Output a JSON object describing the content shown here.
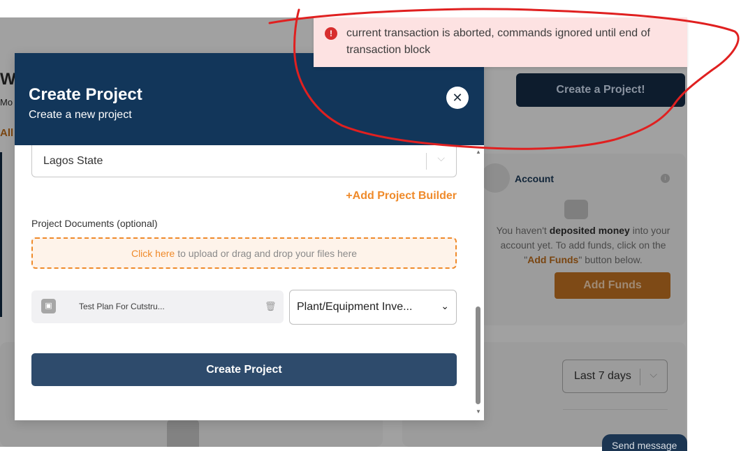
{
  "toast": {
    "message": "current transaction is aborted, commands ignored until end of transaction block",
    "icon": "error-icon",
    "color": "#d72e2e"
  },
  "background": {
    "left_heading": "W",
    "left_sub": "Mo",
    "left_link": "All",
    "create_project_button": "Create a Project!",
    "account": {
      "title": "Account",
      "text_before": "You haven't ",
      "text_bold": "deposited money",
      "text_middle": " into your account yet. To add funds, click on the \"",
      "text_highlight": "Add Funds",
      "text_after": "\" button below.",
      "add_funds_label": "Add Funds"
    },
    "period_select": "Last 7 days",
    "send_message": "Send message"
  },
  "modal": {
    "title": "Create Project",
    "subtitle": "Create a new project",
    "close_glyph": "✕",
    "location_value": "Lagos State",
    "add_builder_label": "+Add Project Builder",
    "documents_label": "Project Documents (optional)",
    "dropzone_link": "Click here",
    "dropzone_text": "to upload or drag and drop your files here",
    "file_name": "Test Plan For Cutstru...",
    "file_type_value": "Plant/Equipment Inve...",
    "submit_label": "Create Project"
  },
  "colors": {
    "modal_header": "#12365a",
    "accent_orange": "#ef8a2a",
    "submit_button": "#2e4b6c",
    "annotation_red": "#e02020"
  }
}
